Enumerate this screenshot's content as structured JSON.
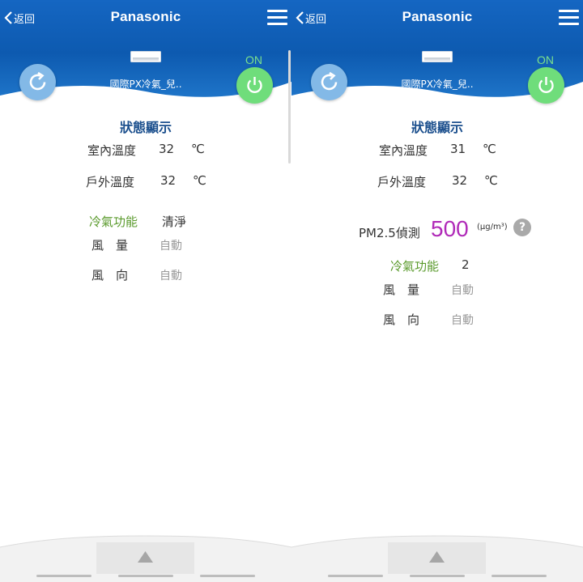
{
  "colors": {
    "header_blue": "#0a5bb0",
    "status_green": "#6fdd7b",
    "refresh_blue": "#83b9e7",
    "pm_value": "#b02ab8",
    "label_green": "#5a9a2c",
    "title_blue": "#1b4f8d"
  },
  "panels": [
    {
      "back_label": "返回",
      "brand": "Panasonic",
      "device_name": "國際PX冷氣_兒..",
      "power_status": "ON",
      "status_title": "狀態顯示",
      "indoor_label": "室內溫度",
      "indoor_value": "32",
      "indoor_unit": "℃",
      "outdoor_label": "戶外溫度",
      "outdoor_value": "32",
      "outdoor_unit": "℃",
      "mode_label": "冷氣功能",
      "mode_value": "清淨",
      "fan_label": "風　量",
      "fan_value": "自動",
      "direction_label": "風　向",
      "direction_value": "自動",
      "icons": {
        "back": "chevron-left-icon",
        "menu": "hamburger-menu-icon",
        "refresh": "refresh-icon",
        "power": "power-icon",
        "up": "triangle-up-icon",
        "device": "air-conditioner-icon"
      }
    },
    {
      "back_label": "返回",
      "brand": "Panasonic",
      "device_name": "國際PX冷氣_兒..",
      "power_status": "ON",
      "status_title": "狀態顯示",
      "indoor_label": "室內溫度",
      "indoor_value": "31",
      "indoor_unit": "℃",
      "outdoor_label": "戶外溫度",
      "outdoor_value": "32",
      "outdoor_unit": "℃",
      "pm_label": "PM2.5偵測",
      "pm_value": "500",
      "pm_unit": "(μg/m³)",
      "pm_help": "?",
      "mode_label": "冷氣功能",
      "mode_value": "2",
      "fan_label": "風　量",
      "fan_value": "自動",
      "direction_label": "風　向",
      "direction_value": "自動",
      "icons": {
        "back": "chevron-left-icon",
        "menu": "hamburger-menu-icon",
        "refresh": "refresh-icon",
        "power": "power-icon",
        "up": "triangle-up-icon",
        "help": "question-icon",
        "device": "air-conditioner-icon"
      }
    }
  ]
}
